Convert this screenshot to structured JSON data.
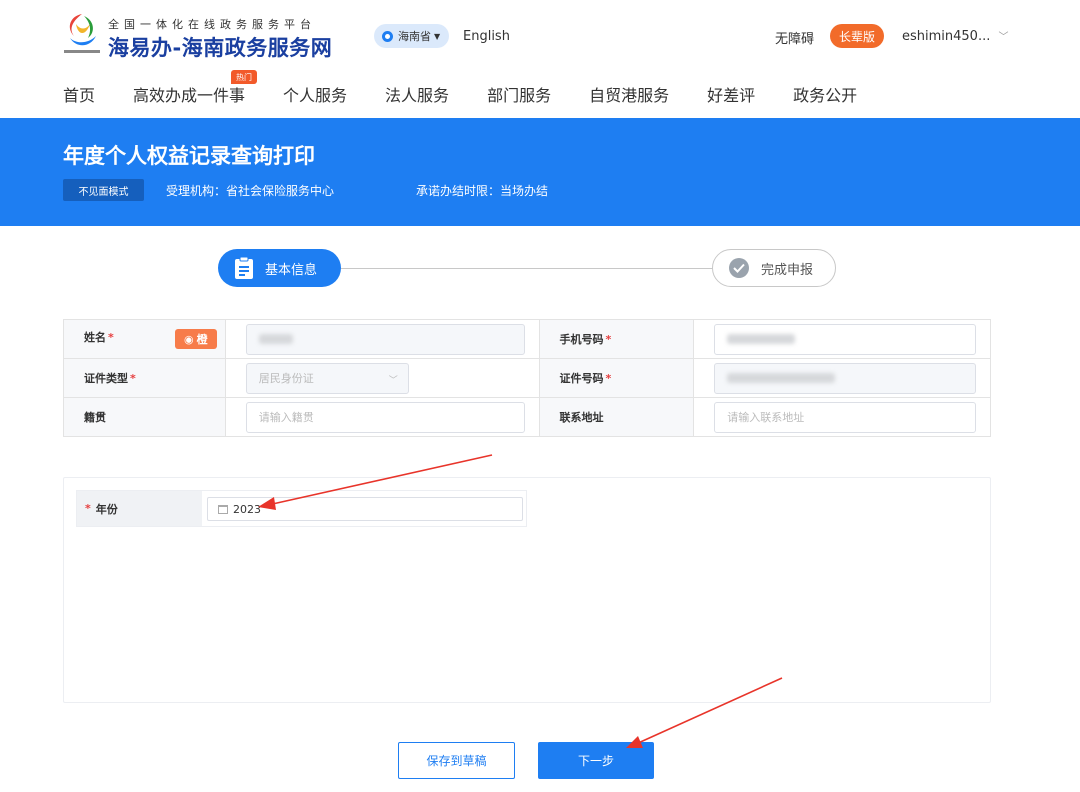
{
  "header": {
    "logo_small": "全国一体化在线政务服务平台",
    "logo_big": "海易办-海南政务服务网",
    "region": "海南省",
    "english": "English",
    "accessibility": "无障碍",
    "elder_mode": "长辈版",
    "user": "eshimin450...",
    "colors": {
      "brand_blue": "#1e7ef2",
      "elder_orange": "#f26b2a"
    }
  },
  "nav": {
    "items": [
      {
        "label": "首页"
      },
      {
        "label": "高效办成一件事",
        "badge": "热门"
      },
      {
        "label": "个人服务"
      },
      {
        "label": "法人服务"
      },
      {
        "label": "部门服务"
      },
      {
        "label": "自贸港服务"
      },
      {
        "label": "好差评"
      },
      {
        "label": "政务公开"
      }
    ]
  },
  "banner": {
    "title": "年度个人权益记录查询打印",
    "mode": "不见面模式",
    "agency": "受理机构：省社会保险服务中心",
    "limit": "承诺办结时限：当场办结"
  },
  "steps": [
    {
      "label": "基本信息",
      "state": "active"
    },
    {
      "label": "完成申报",
      "state": "pending"
    }
  ],
  "form": {
    "name_label": "姓名",
    "fill_button": "🔘橙",
    "phone_label": "手机号码",
    "id_type_label": "证件类型",
    "id_type_value": "居民身份证",
    "id_number_label": "证件号码",
    "native_label": "籍贯",
    "native_placeholder": "请输入籍贯",
    "address_label": "联系地址",
    "address_placeholder": "请输入联系地址",
    "required_mark": "*"
  },
  "year": {
    "label": "年份",
    "required_mark": "*",
    "value": "2023"
  },
  "buttons": {
    "save_draft": "保存到草稿",
    "next": "下一步"
  }
}
